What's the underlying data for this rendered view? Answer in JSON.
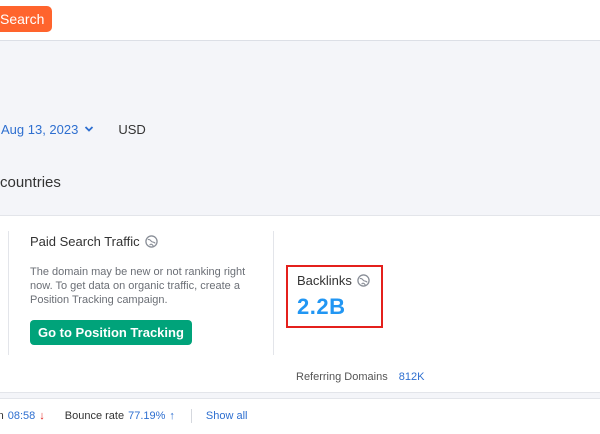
{
  "topbar": {
    "search_label": "Search"
  },
  "filters": {
    "date": "Aug 13, 2023",
    "currency": "USD"
  },
  "section": {
    "title": "countries"
  },
  "paid": {
    "title": "Paid Search Traffic",
    "description": "The domain may be new or not ranking right now. To get data on organic traffic, create a Position Tracking campaign.",
    "button_label": "Go to Position Tracking"
  },
  "backlinks": {
    "title": "Backlinks",
    "value": "2.2B",
    "referring_label": "Referring Domains",
    "referring_value": "812K"
  },
  "stats": {
    "duration_label": "tion",
    "duration_value": "08:58",
    "duration_arrow": "↓",
    "bounce_label": "Bounce rate",
    "bounce_value": "77.19%",
    "bounce_arrow": "↑",
    "show_all_label": "Show all"
  },
  "colors": {
    "accent_orange": "#ff642d",
    "green": "#00a37a",
    "blue": "#2196f3",
    "link": "#2e6fd0",
    "highlight": "#e4201c"
  }
}
